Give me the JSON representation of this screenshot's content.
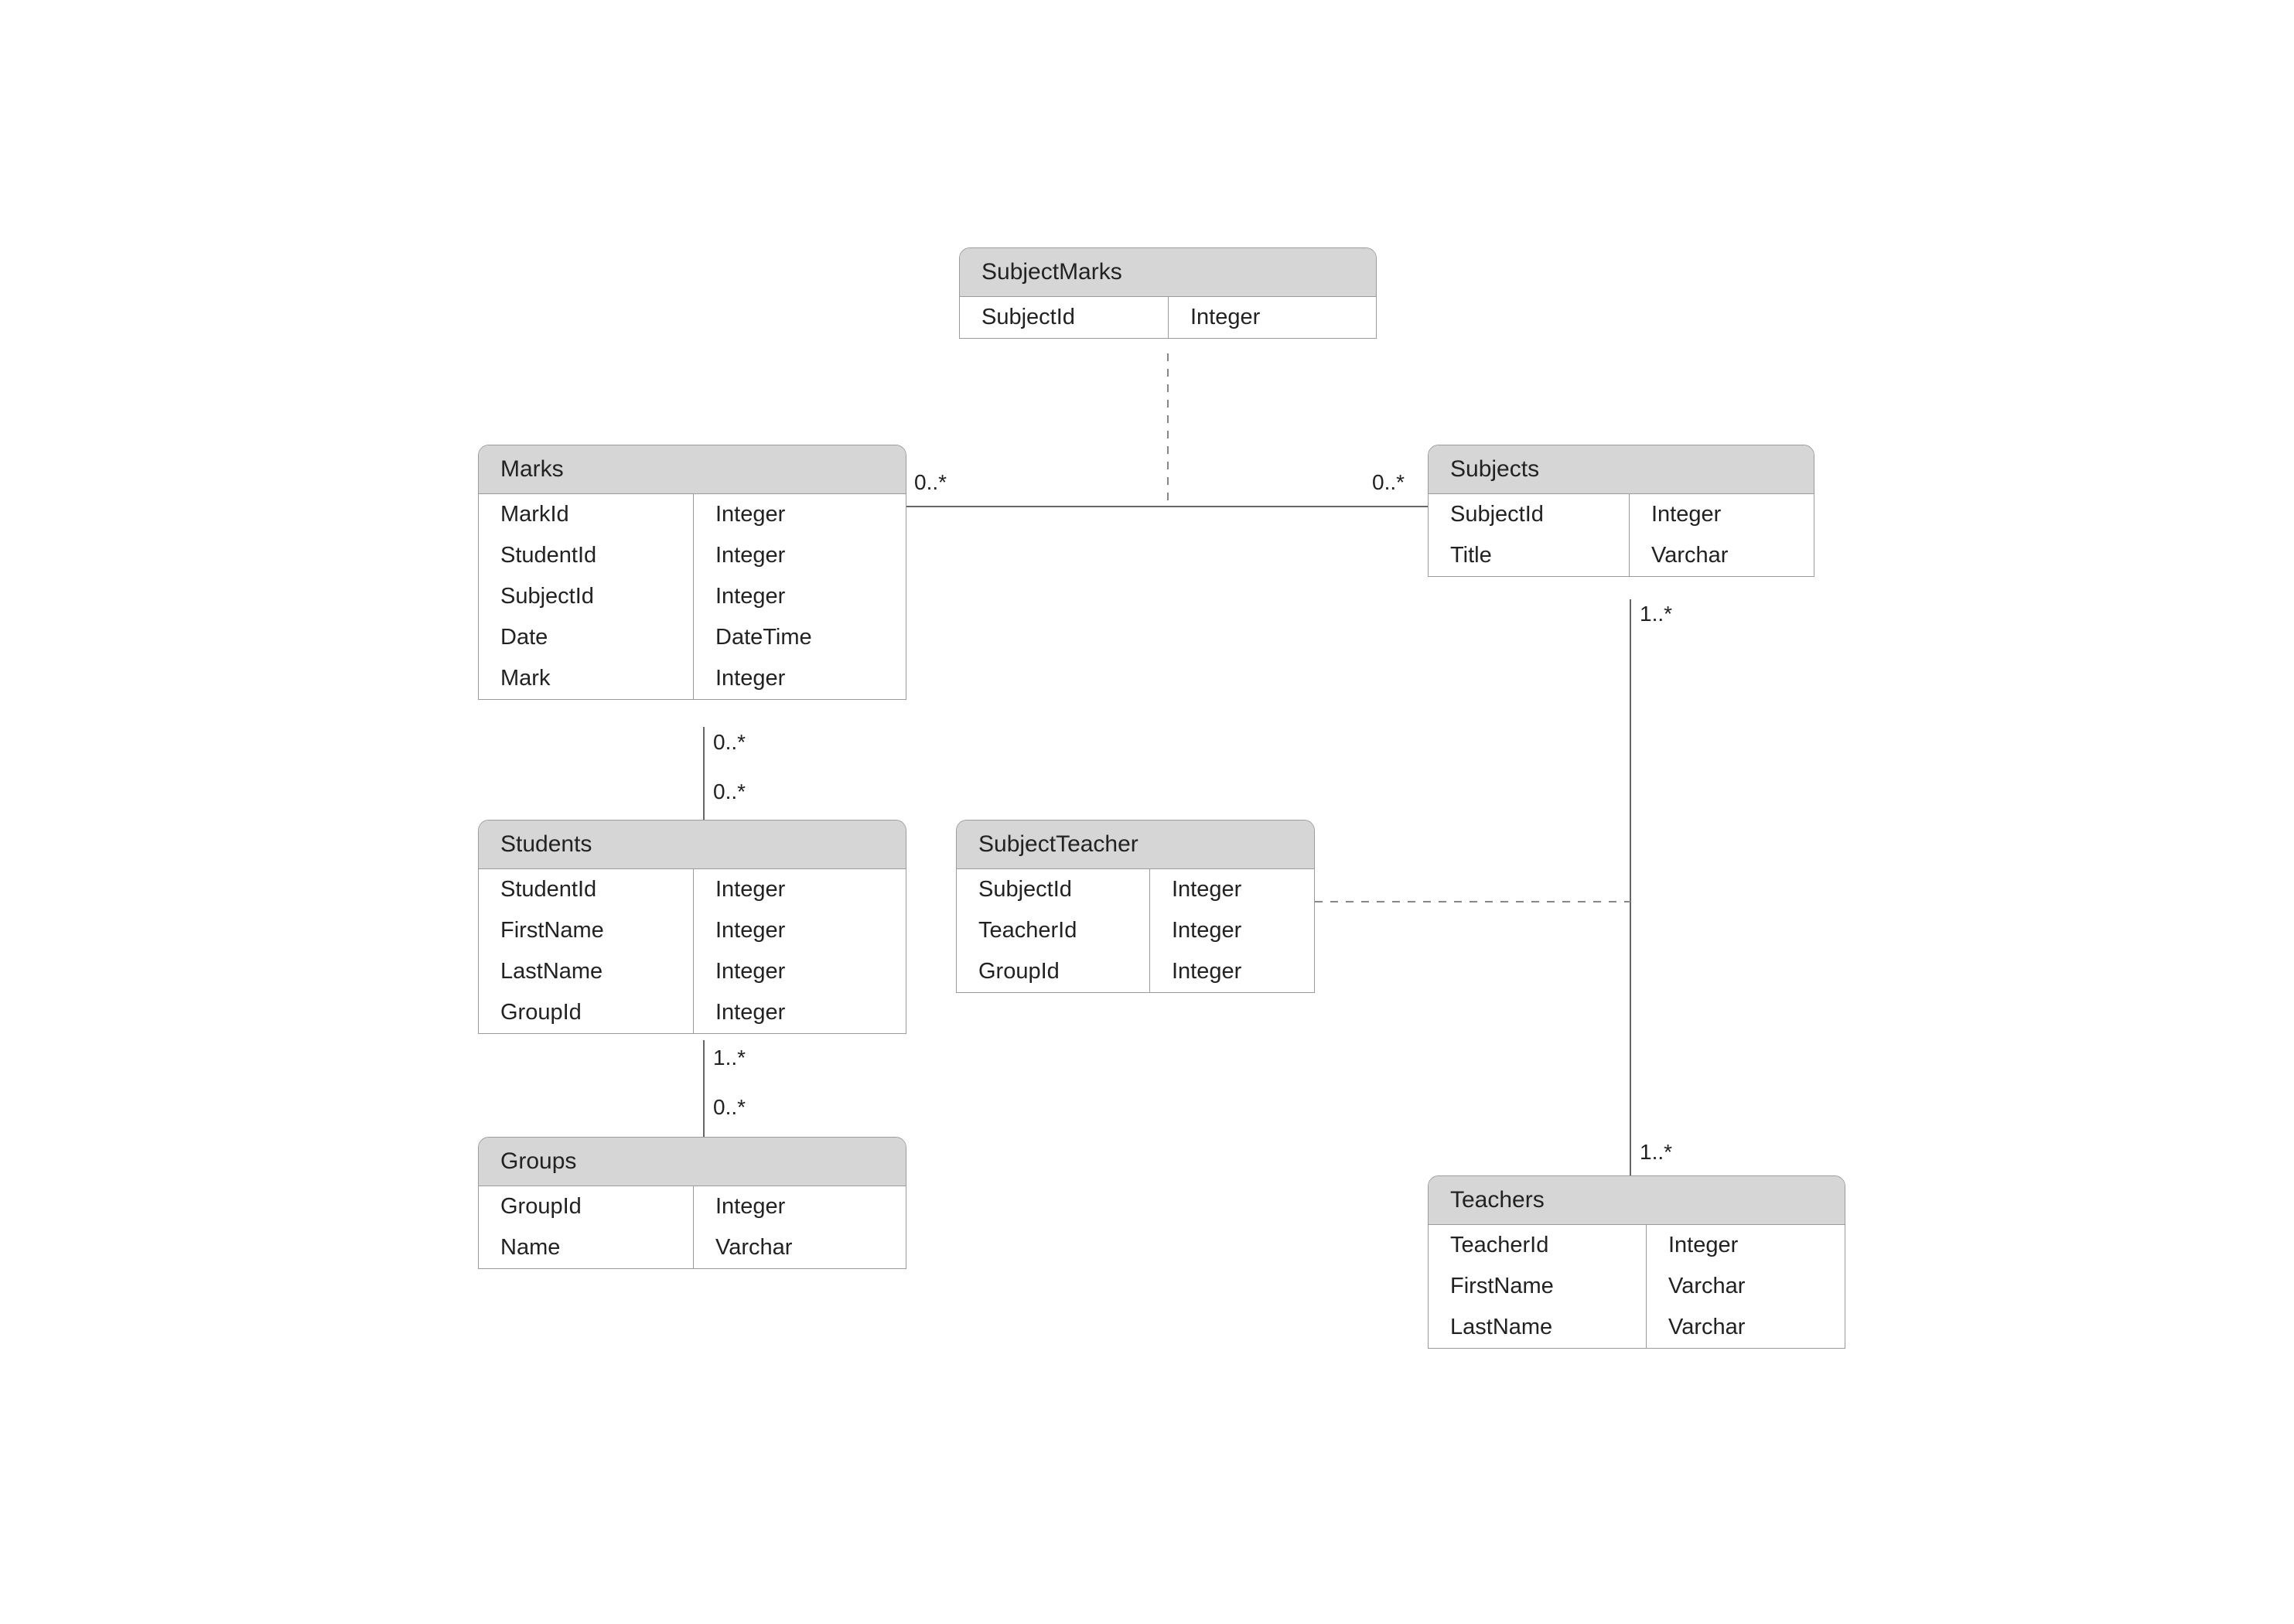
{
  "diagram": {
    "entities": {
      "subjectMarks": {
        "title": "SubjectMarks",
        "rows": [
          {
            "name": "SubjectId",
            "type": "Integer"
          }
        ]
      },
      "marks": {
        "title": "Marks",
        "rows": [
          {
            "name": "MarkId",
            "type": "Integer"
          },
          {
            "name": "StudentId",
            "type": "Integer"
          },
          {
            "name": "SubjectId",
            "type": "Integer"
          },
          {
            "name": "Date",
            "type": "DateTime"
          },
          {
            "name": "Mark",
            "type": "Integer"
          }
        ]
      },
      "subjects": {
        "title": "Subjects",
        "rows": [
          {
            "name": "SubjectId",
            "type": "Integer"
          },
          {
            "name": "Title",
            "type": "Varchar"
          }
        ]
      },
      "students": {
        "title": "Students",
        "rows": [
          {
            "name": "StudentId",
            "type": "Integer"
          },
          {
            "name": "FirstName",
            "type": "Integer"
          },
          {
            "name": "LastName",
            "type": "Integer"
          },
          {
            "name": "GroupId",
            "type": "Integer"
          }
        ]
      },
      "subjectTeacher": {
        "title": "SubjectTeacher",
        "rows": [
          {
            "name": "SubjectId",
            "type": "Integer"
          },
          {
            "name": "TeacherId",
            "type": "Integer"
          },
          {
            "name": "GroupId",
            "type": "Integer"
          }
        ]
      },
      "groups": {
        "title": "Groups",
        "rows": [
          {
            "name": "GroupId",
            "type": "Integer"
          },
          {
            "name": "Name",
            "type": "Varchar"
          }
        ]
      },
      "teachers": {
        "title": "Teachers",
        "rows": [
          {
            "name": "TeacherId",
            "type": "Integer"
          },
          {
            "name": "FirstName",
            "type": "Varchar"
          },
          {
            "name": "LastName",
            "type": "Varchar"
          }
        ]
      }
    },
    "labels": {
      "marksSubjectsLeft": "0..*",
      "marksSubjectsRight": "0..*",
      "subjectsTeachersTop": "1..*",
      "subjectsTeachersBottom": "1..*",
      "marksStudentsTop": "0..*",
      "marksStudentsBottom": "0..*",
      "studentsGroupsTop": "1..*",
      "studentsGroupsBottom": "0..*"
    }
  }
}
